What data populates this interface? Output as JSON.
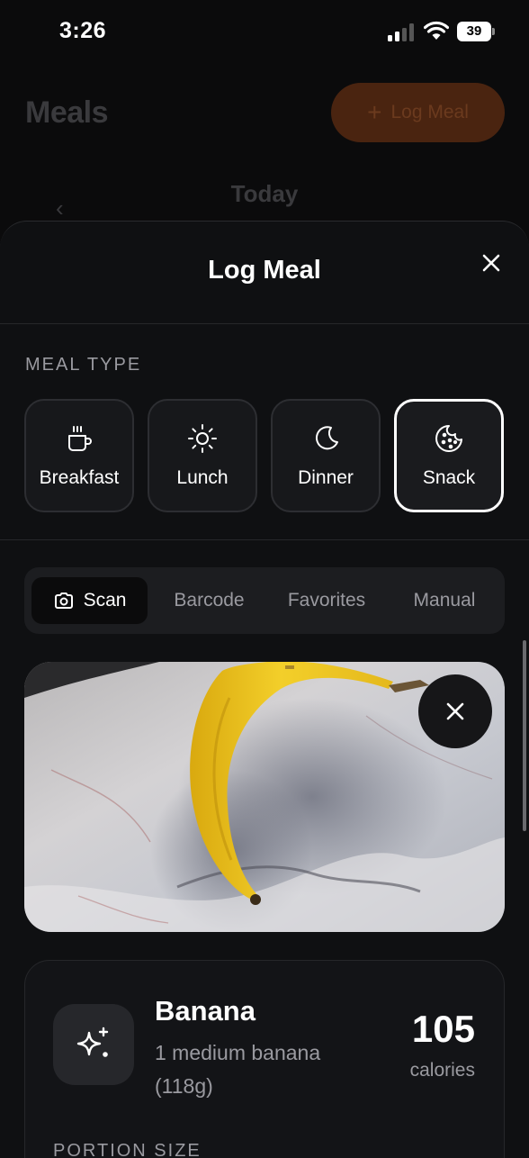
{
  "status_bar": {
    "time": "3:26",
    "battery": "39"
  },
  "background": {
    "title": "Meals",
    "log_button": "Log Meal",
    "date_title": "Today"
  },
  "sheet": {
    "title": "Log Meal",
    "meal_type_label": "MEAL TYPE",
    "meal_types": [
      {
        "label": "Breakfast",
        "icon": "coffee-cup-icon",
        "selected": false
      },
      {
        "label": "Lunch",
        "icon": "sun-icon",
        "selected": false
      },
      {
        "label": "Dinner",
        "icon": "moon-icon",
        "selected": false
      },
      {
        "label": "Snack",
        "icon": "cookie-icon",
        "selected": true
      }
    ],
    "tabs": [
      {
        "label": "Scan",
        "icon": "camera-icon",
        "active": true
      },
      {
        "label": "Barcode",
        "active": false
      },
      {
        "label": "Favorites",
        "active": false
      },
      {
        "label": "Manual",
        "active": false
      }
    ],
    "result": {
      "name": "Banana",
      "portion": "1 medium banana (118g)",
      "calories": "105",
      "calories_unit": "calories",
      "portion_size_label": "PORTION SIZE"
    }
  },
  "colors": {
    "accent": "#e8692a",
    "sheet_bg": "#0f1012",
    "card_bg": "#17181b",
    "muted_text": "#9a9aa0"
  }
}
